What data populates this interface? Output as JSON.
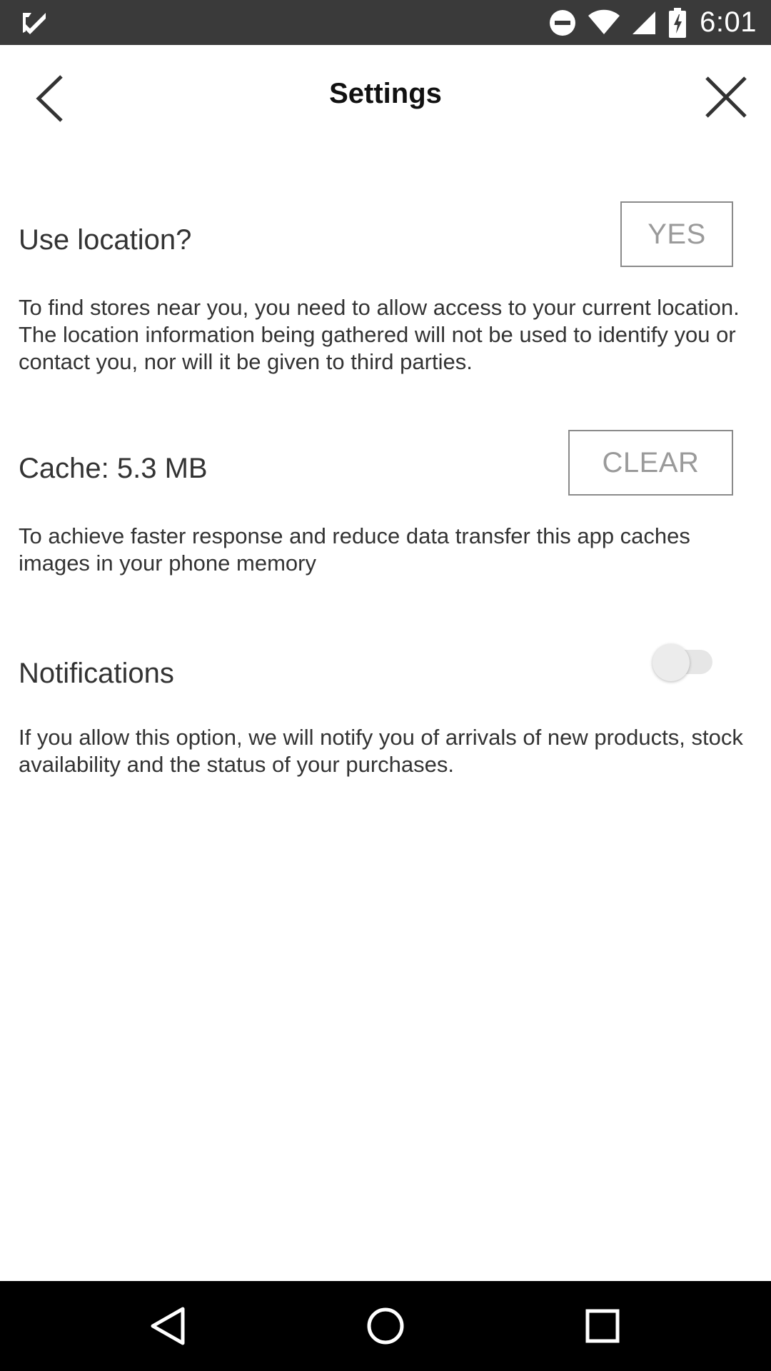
{
  "status_bar": {
    "time": "6:01",
    "icons": [
      "tasks-check-icon",
      "do-not-disturb-icon",
      "wifi-icon",
      "signal-icon",
      "battery-charging-icon"
    ]
  },
  "header": {
    "title": "Settings",
    "back_icon": "chevron-left-icon",
    "close_icon": "close-icon"
  },
  "settings": {
    "location": {
      "label": "Use location?",
      "button_label": "YES",
      "description": "To find stores near you, you need to allow access to your current location. The location information being gathered will not be used to identify you or contact you, nor will it be given to third parties."
    },
    "cache": {
      "label": "Cache: 5.3 MB",
      "button_label": "CLEAR",
      "description": "To achieve faster response and reduce data transfer this app caches images in your phone memory"
    },
    "notifications": {
      "label": "Notifications",
      "enabled": false,
      "description": "If you allow this option, we will notify you of arrivals of new products, stock availability and the status of your purchases."
    }
  },
  "nav_bar": {
    "buttons": [
      "back-triangle-icon",
      "home-circle-icon",
      "recents-square-icon"
    ]
  },
  "colors": {
    "status_bar_bg": "#3a3a3a",
    "nav_bar_bg": "#000000",
    "button_border": "#8a8a8a",
    "button_text": "#9a9a9a",
    "text": "#333333"
  }
}
